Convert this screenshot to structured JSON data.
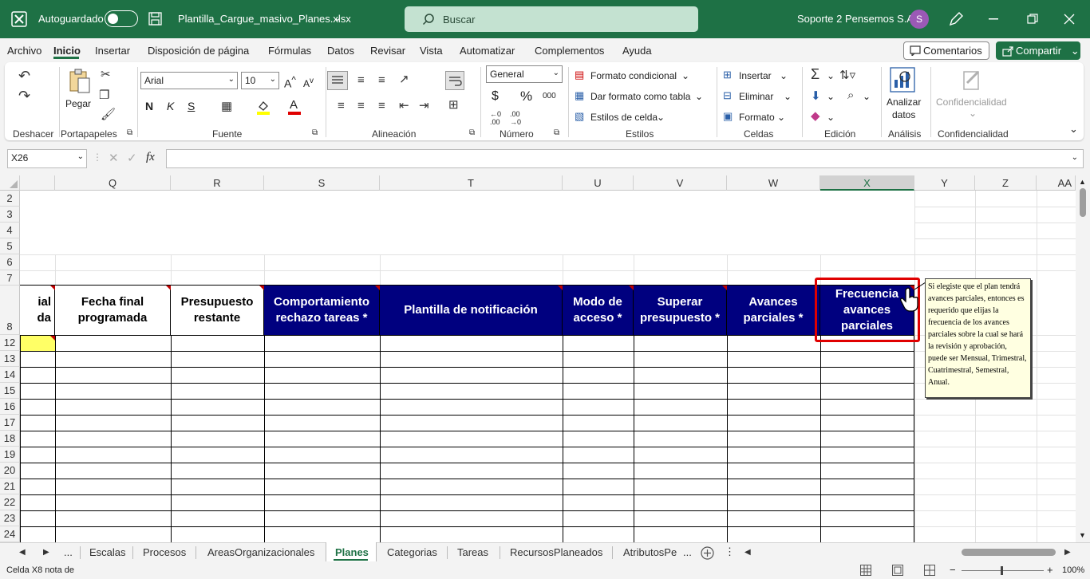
{
  "titlebar": {
    "autosave_label": "Autoguardado",
    "filename": "Plantilla_Cargue_masivo_Planes.xlsx",
    "search_placeholder": "Buscar",
    "user_name": "Soporte 2 Pensemos S.A.",
    "avatar_initial": "S"
  },
  "menu": {
    "items": [
      "Archivo",
      "Inicio",
      "Insertar",
      "Disposición de página",
      "Fórmulas",
      "Datos",
      "Revisar",
      "Vista",
      "Automatizar",
      "Complementos",
      "Ayuda"
    ],
    "comments_label": "Comentarios",
    "share_label": "Compartir"
  },
  "ribbon": {
    "groups": {
      "undo": "Deshacer",
      "clipboard": "Portapapeles",
      "font": "Fuente",
      "alignment": "Alineación",
      "number": "Número",
      "styles": "Estilos",
      "cells": "Celdas",
      "editing": "Edición",
      "analysis": "Análisis",
      "sensitivity": "Confidencialidad"
    },
    "paste_label": "Pegar",
    "font_name": "Arial",
    "font_size": "10",
    "font_buttons": {
      "bold": "N",
      "italic": "K",
      "underline": "S"
    },
    "number_format": "General",
    "conditional_format": "Formato condicional",
    "format_as_table": "Dar formato como tabla",
    "cell_styles": "Estilos de celda",
    "insert": "Insertar",
    "delete": "Eliminar",
    "format": "Formato",
    "analyze_data_line1": "Analizar",
    "analyze_data_line2": "datos",
    "sensitivity_button": "Confidencialidad"
  },
  "formula_bar": {
    "name_box": "X26",
    "fx": "fx",
    "content": ""
  },
  "grid": {
    "columns": [
      "Q",
      "R",
      "S",
      "T",
      "U",
      "V",
      "W",
      "X",
      "Y",
      "Z",
      "AA"
    ],
    "selected_column": "X",
    "rows": [
      "2",
      "3",
      "4",
      "5",
      "6",
      "7",
      "8",
      "12",
      "13",
      "14",
      "15",
      "16",
      "17",
      "18",
      "19",
      "20",
      "21",
      "22",
      "23",
      "24"
    ],
    "headers": {
      "partial_line1": "ial",
      "partial_line2": "da",
      "q": "Fecha final programada",
      "r": "Presupuesto restante",
      "s": "Comportamiento rechazo tareas *",
      "t": "Plantilla de notificación",
      "u": "Modo de acceso *",
      "v": "Superar presupuesto *",
      "w": "Avances parciales *",
      "x": "Frecuencia avances parciales"
    },
    "note_text": "Si elegiste que el plan tendrá avances parciales, entonces es requerido que elijas  la frecuencia de los avances parciales sobre la cual se hará la revisión y aprobación,  puede ser Mensual, Trimestral, Cuatrimestral, Semestral, Anual."
  },
  "sheet_tabs": {
    "tabs": [
      "Escalas",
      "Procesos",
      "AreasOrganizacionales",
      "Planes",
      "Categorias",
      "Tareas",
      "RecursosPlaneados",
      "AtributosPe"
    ],
    "active": "Planes",
    "more": "..."
  },
  "status_bar": {
    "message": "Celda X8 nota de",
    "zoom": "100%"
  },
  "colors": {
    "excel_green": "#1e7145",
    "header_blue": "#00007f",
    "highlight_red": "#e00000",
    "note_yellow": "#ffffe1"
  }
}
